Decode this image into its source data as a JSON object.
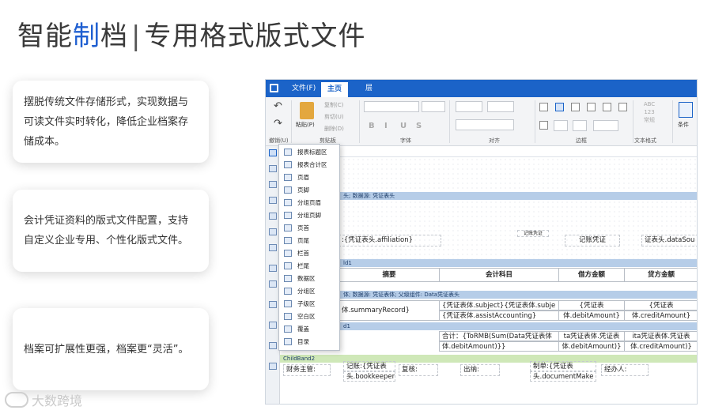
{
  "title": {
    "part1": "智能",
    "part2": "制",
    "part3": "档",
    "separator": "|",
    "part4": "专用格式版式文件"
  },
  "cards": [
    "摆脱传统文件存储形式，实现数据与可读文件实时转化，降低企业档案存储成本。",
    "会计凭证资料的版式文件配置，支持自定义企业专用、个性化版式文件。",
    "档案可扩展性更强，档案更“灵活”。"
  ],
  "watermark": "大数跨境",
  "app": {
    "tabs": [
      "文件(F)",
      "主页",
      "层"
    ],
    "ribbon": {
      "undo_group": "撤销(U)",
      "clipboard": {
        "paste": "粘贴(P)",
        "copy": "复制(C)",
        "cut": "剪切(U)",
        "delete": "删除(D)",
        "group": "剪贴板"
      },
      "font_group": "字体",
      "format_buttons": [
        "B",
        "I",
        "U",
        "S"
      ],
      "align_group": "对齐",
      "border_group": "边框",
      "textformat": {
        "line1": "ABC",
        "line2": "123",
        "line3": "常规",
        "group": "文本格式"
      },
      "condition": "条件"
    },
    "menu": [
      "报表标题区",
      "报表合计区",
      "页眉",
      "页脚",
      "分组页眉",
      "分组页脚",
      "页首",
      "页尾",
      "栏首",
      "栏尾",
      "数据区",
      "分组区",
      "子级区",
      "空白区",
      "覆盖",
      "目录"
    ],
    "bands": {
      "b1": "头; 数据源: 凭证表头",
      "b2": "ld1",
      "b3": "体; 数据源: 凭证表体; 父级组件: Data凭证表头",
      "b4": "d1",
      "b5": "ChildBand2"
    },
    "cells": {
      "affiliation": ":{凭证表头.affiliation}",
      "voucher_title": "记账凭证",
      "small_label": "记账凭证",
      "datasource": "证表头.dataSou",
      "h_summary": "摘要",
      "h_account": "会计科目",
      "h_debit": "借方金额",
      "h_credit": "贷方金额",
      "summary_record": "体.summaryRecord}",
      "subject": "{凭证表体.subject}{凭证表体.subje",
      "assist": "{凭证表体.assistAccounting}",
      "debit1": "{凭证表",
      "debit2": "体.debitAmount}",
      "credit1": "{凭证表",
      "credit2": "体.creditAmount}",
      "total1": "合计：{ToRMB(Sum(Data凭证表体",
      "total2": "体.debitAmount)}}",
      "total_debit1": "ta凭证表体.凭证表",
      "total_debit2": "体.debitAmount)}",
      "total_credit1": "ita凭证表体.凭证表",
      "total_credit2": "体.creditAmount)}",
      "finance": "财务主管:",
      "bookkeeper1": "记账:{凭证表",
      "bookkeeper2": "头.bookkeeper}",
      "review": "复核:",
      "cashier": "出纳:",
      "maker1": "制单:{凭证表",
      "maker2": "头.documentMake",
      "handler": "经办人:"
    }
  },
  "colors": {
    "accent": "#1f5fd1",
    "tabbar": "#1b63c8",
    "band_blue": "#b6cde8",
    "band_green": "#cfe8b8"
  }
}
